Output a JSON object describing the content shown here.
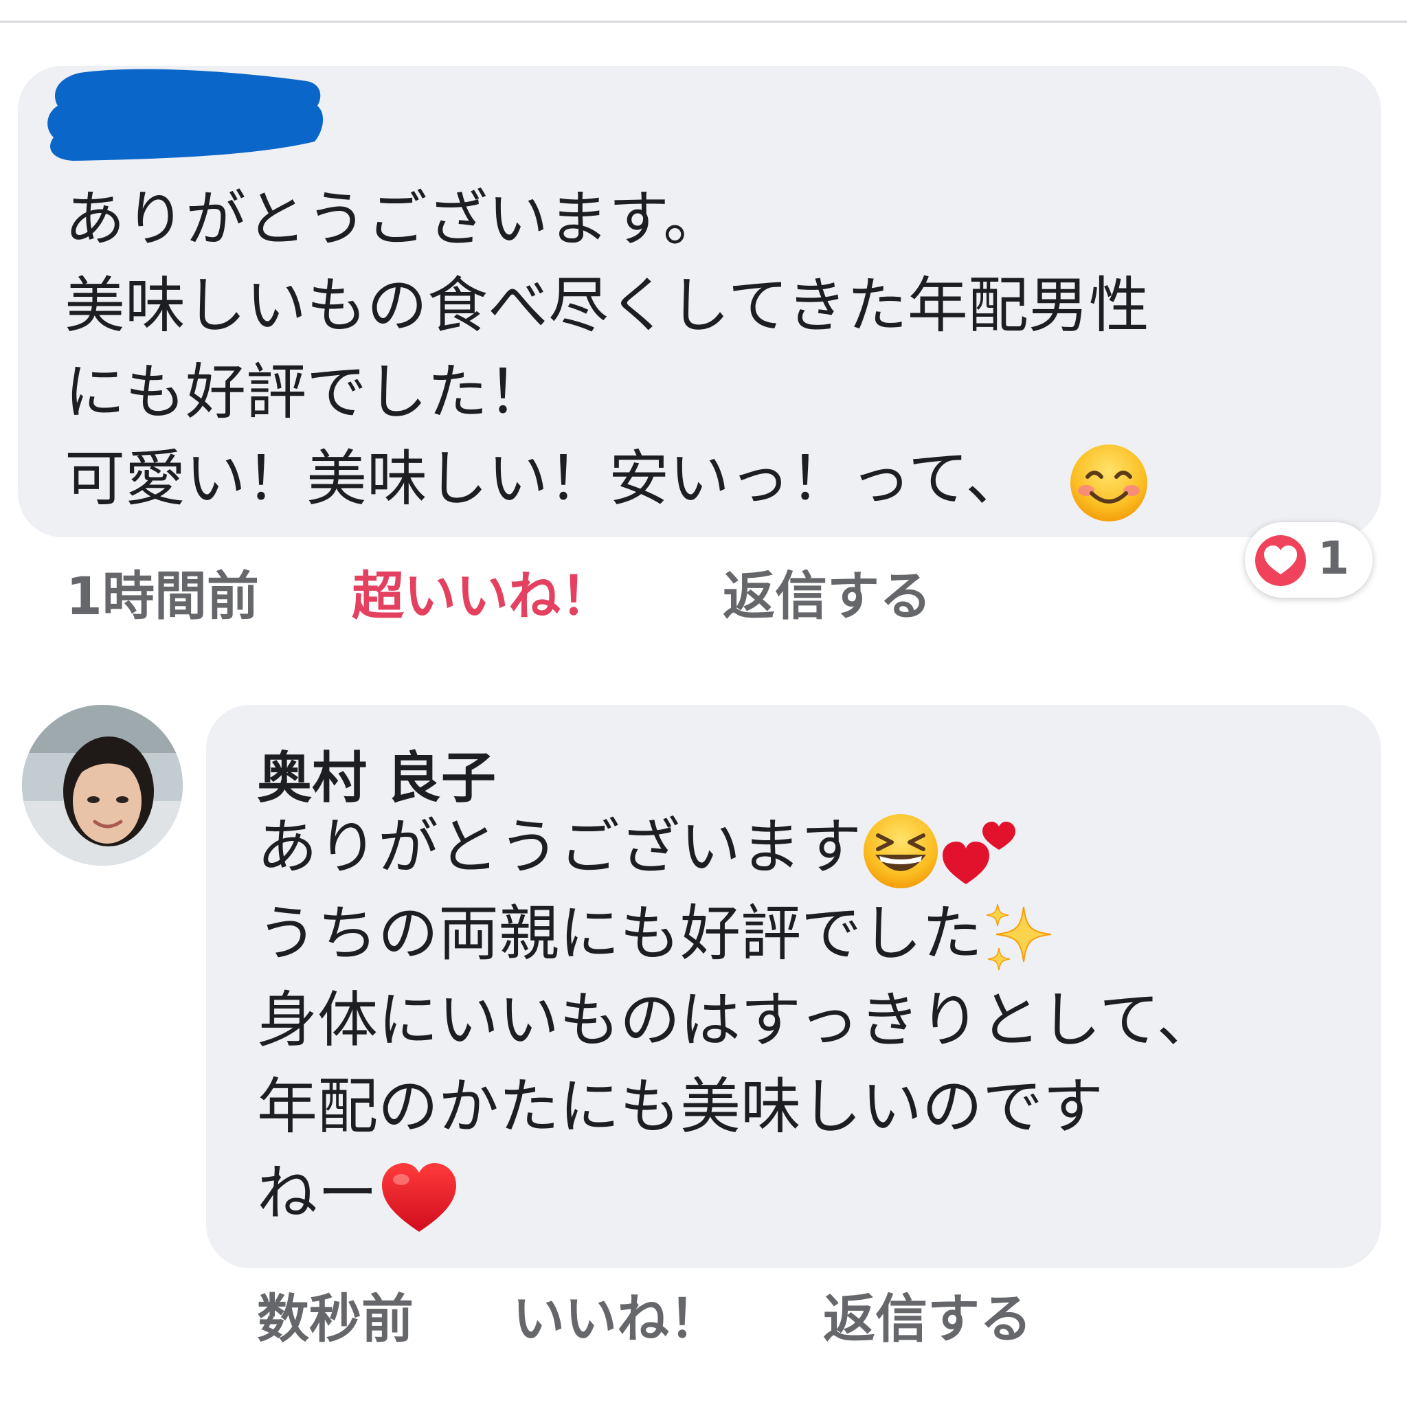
{
  "comments": [
    {
      "lines": [
        "ありがとうございます。",
        "美味しいもの食べ尽くしてきた年配男性",
        "にも好評でした！",
        "可愛い！美味しい！安いっ！って、"
      ],
      "timestamp": "1時間前",
      "reaction_label": "超いいね！",
      "reply_label": "返信する",
      "reaction_count": "1",
      "reaction_icon": "heart-reaction-icon",
      "emoji": "smiling-face-icon"
    },
    {
      "author": "奥村 良子",
      "lines": [
        "ありがとうございます",
        "うちの両親にも好評でした",
        "身体にいいものはすっきりとして、",
        "年配のかたにも美味しいのです",
        "ねー"
      ],
      "timestamp": "数秒前",
      "like_label": "いいね！",
      "reply_label": "返信する",
      "emojis": [
        "grinning-squinting-face-icon",
        "two-hearts-icon",
        "sparkles-icon",
        "red-heart-icon"
      ]
    }
  ],
  "colors": {
    "bubble": "#eff0f4",
    "text": "#1c1e21",
    "meta": "#65676b",
    "reaction_active": "#e4405f",
    "redaction": "#0a66c8"
  }
}
